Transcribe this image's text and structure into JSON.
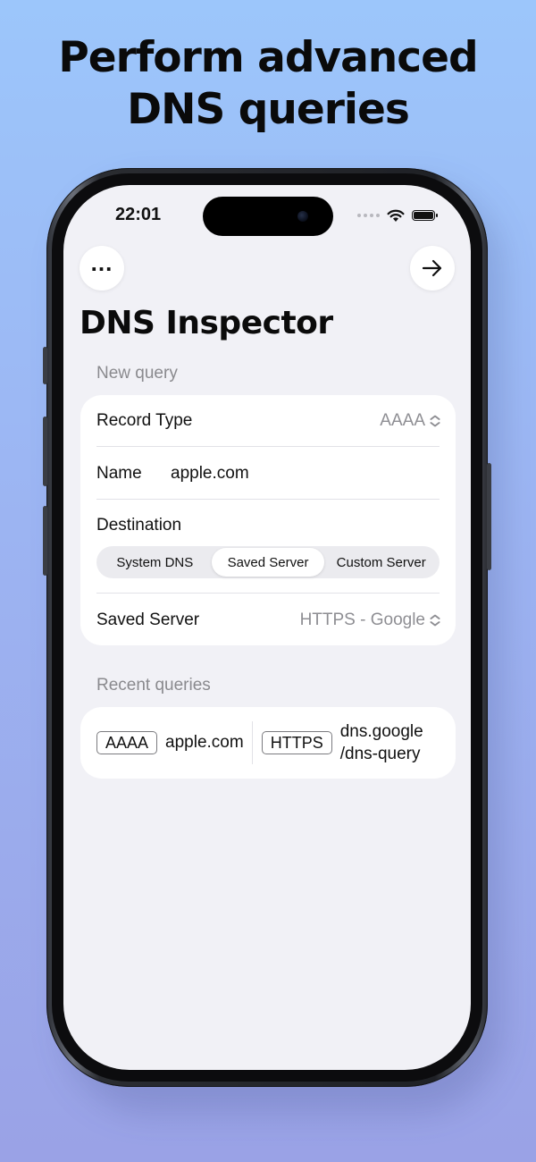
{
  "headline": {
    "line1": "Perform advanced",
    "line2": "DNS queries"
  },
  "status_bar": {
    "time": "22:01"
  },
  "toolbar": {
    "menu_icon": "ellipsis-icon",
    "go_icon": "arrow-right-icon"
  },
  "title": "DNS Inspector",
  "new_query": {
    "header": "New query",
    "record_type_label": "Record Type",
    "record_type_value": "AAAA",
    "name_label": "Name",
    "name_value": "apple.com",
    "destination_label": "Destination",
    "destination_options": [
      "System DNS",
      "Saved Server",
      "Custom Server"
    ],
    "destination_selected": "Saved Server",
    "saved_server_label": "Saved Server",
    "saved_server_value": "HTTPS - Google"
  },
  "recent_queries": {
    "header": "Recent queries",
    "items": [
      {
        "type": "AAAA",
        "name": "apple.com",
        "protocol": "HTTPS",
        "server_line1": "dns.google",
        "server_line2": "/dns-query"
      }
    ]
  }
}
